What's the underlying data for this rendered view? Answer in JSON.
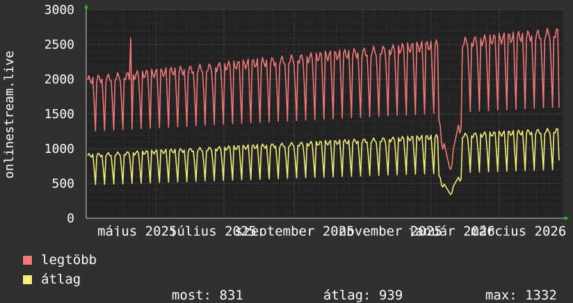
{
  "chart_data": {
    "type": "line",
    "ylabel": "onlinestream.live",
    "ylim": [
      0,
      3000
    ],
    "yticks": [
      0,
      500,
      1000,
      1500,
      2000,
      2500,
      3000
    ],
    "xticks": [
      "május 2025",
      "július 2025",
      "szeptember 2025",
      "november 2025",
      "január 2026",
      "március 2026"
    ],
    "x_range": [
      "2025-04-01",
      "2026-03-28"
    ],
    "grid": true,
    "legend_position": "bottom-left",
    "series": [
      {
        "name": "legtöbb",
        "color": "#f47a7a",
        "weekday_peak_start": 2050,
        "weekday_peak_end": 2750,
        "weekend_low_start": 1250,
        "weekend_low_end": 1600,
        "spike_may": 2590,
        "winter_dip_min": 700,
        "last": 1590
      },
      {
        "name": "átlag",
        "color": "#f5f07a",
        "weekday_peak_start": 930,
        "weekday_peak_end": 1300,
        "weekend_low_start": 480,
        "weekend_low_end": 700,
        "winter_dip_min": 350,
        "last": 831
      }
    ]
  },
  "stats": {
    "most_label": "most:",
    "most_value": "831",
    "atlag_label": "átlag:",
    "atlag_value": "939",
    "max_label": "max:",
    "max_value": "1332"
  }
}
